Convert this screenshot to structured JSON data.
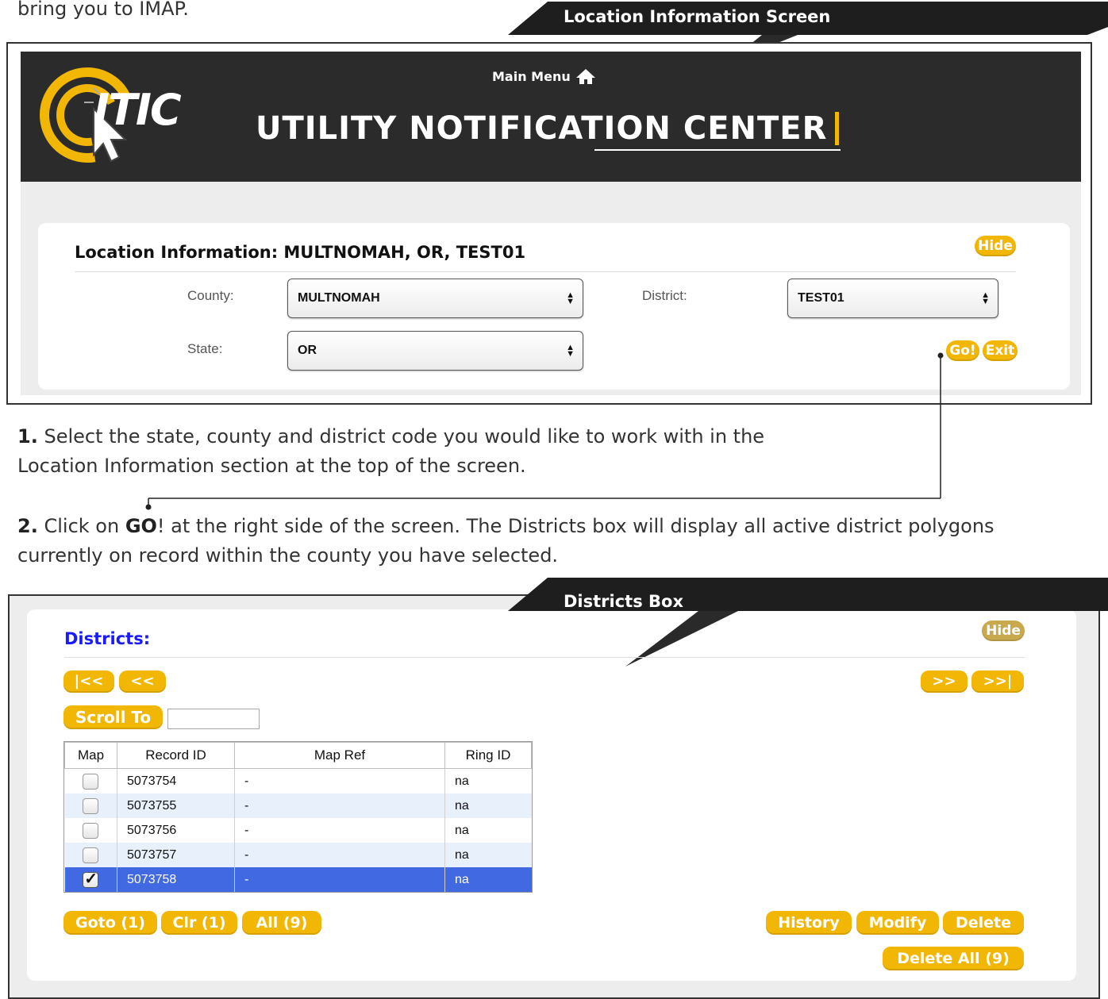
{
  "intro_text": "bring you to IMAP.",
  "callout_location": "Location Information Screen",
  "callout_districts": "Districts Box",
  "app": {
    "logo_text": "ITIC",
    "main_menu": "Main Menu",
    "title": "UTILITY NOTIFICATION CENTER"
  },
  "location": {
    "heading": "Location Information: MULTNOMAH, OR, TEST01",
    "hide": "Hide",
    "county_label": "County:",
    "county_value": "MULTNOMAH",
    "district_label": "District:",
    "district_value": "TEST01",
    "state_label": "State:",
    "state_value": "OR",
    "go": "Go!",
    "exit": "Exit"
  },
  "step1": {
    "num": "1.",
    "text_a": "Select the state, county and district code you would like to work with in the",
    "text_b": "Location Information section at the top of the screen."
  },
  "step2": {
    "num": "2.",
    "pre": "Click on ",
    "bold": "GO",
    "post": "! at the right side of the screen. The Districts box will display all active district polygons",
    "line2": "currently on record within the county you have selected."
  },
  "districts": {
    "heading": "Districts:",
    "hide": "Hide",
    "first": "|<<",
    "prev": "<<",
    "next": ">>",
    "last": ">>|",
    "scroll_to": "Scroll To",
    "columns": [
      "Map",
      "Record ID",
      "Map Ref",
      "Ring ID"
    ],
    "rows": [
      {
        "checked": false,
        "record_id": "5073754",
        "map_ref": "-",
        "ring_id": "na"
      },
      {
        "checked": false,
        "record_id": "5073755",
        "map_ref": "-",
        "ring_id": "na"
      },
      {
        "checked": false,
        "record_id": "5073756",
        "map_ref": "-",
        "ring_id": "na"
      },
      {
        "checked": false,
        "record_id": "5073757",
        "map_ref": "-",
        "ring_id": "na"
      },
      {
        "checked": true,
        "record_id": "5073758",
        "map_ref": "-",
        "ring_id": "na"
      }
    ],
    "goto": "Goto (1)",
    "clr": "Clr (1)",
    "all": "All (9)",
    "history": "History",
    "modify": "Modify",
    "delete": "Delete",
    "delete_all": "Delete All (9)"
  },
  "colors": {
    "accent_yellow": "#f2b705",
    "header_dark": "#2b2b2b",
    "districts_heading": "#1a1aff",
    "selected_row": "#4169e1"
  }
}
